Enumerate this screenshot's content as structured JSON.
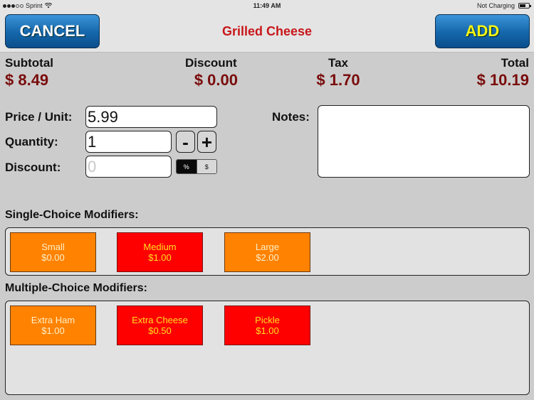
{
  "status_bar": {
    "carrier": "Sprint",
    "signal_bars_filled": 3,
    "signal_bars_total": 5,
    "time": "11:49 AM",
    "battery_status": "Not Charging"
  },
  "nav": {
    "cancel_label": "CANCEL",
    "title": "Grilled Cheese",
    "add_label": "ADD"
  },
  "totals": {
    "subtotal_label": "Subtotal",
    "subtotal_value": "$ 8.49",
    "discount_label": "Discount",
    "discount_value": "$ 0.00",
    "tax_label": "Tax",
    "tax_value": "$ 1.70",
    "total_label": "Total",
    "total_value": "$ 10.19"
  },
  "form": {
    "price_label": "Price / Unit:",
    "price_value": "5.99",
    "quantity_label": "Quantity:",
    "quantity_value": "1",
    "minus_label": "-",
    "plus_label": "+",
    "discount_label": "Discount:",
    "discount_placeholder": "0",
    "discount_type_options": [
      "%",
      "$"
    ],
    "discount_type_selected": "%",
    "notes_label": "Notes:",
    "notes_value": ""
  },
  "single_choice": {
    "title": "Single-Choice Modifiers:",
    "items": [
      {
        "name": "Small",
        "price": "$0.00",
        "selected": false
      },
      {
        "name": "Medium",
        "price": "$1.00",
        "selected": true
      },
      {
        "name": "Large",
        "price": "$2.00",
        "selected": false
      }
    ]
  },
  "multiple_choice": {
    "title": "Multiple-Choice Modifiers:",
    "items": [
      {
        "name": "Extra Ham",
        "price": "$1.00",
        "selected": false
      },
      {
        "name": "Extra Cheese",
        "price": "$0.50",
        "selected": true
      },
      {
        "name": "Pickle",
        "price": "$1.00",
        "selected": true
      }
    ]
  },
  "colors": {
    "title_red": "#c8161a",
    "amount_red": "#7a0c0c",
    "modifier_unselected": "#ff8200",
    "modifier_selected": "#ff0000",
    "button_blue": "#1466aa",
    "add_text_yellow": "#f5f515"
  }
}
